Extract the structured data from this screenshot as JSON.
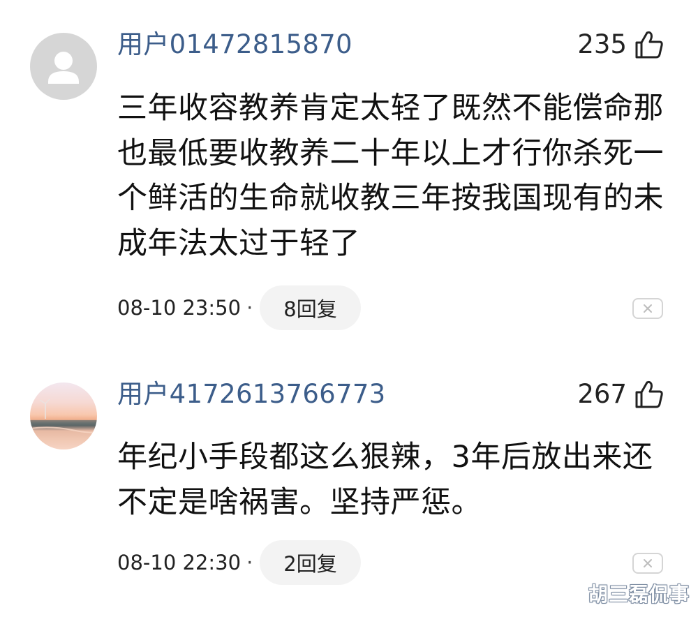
{
  "comments": [
    {
      "username": "用户01472815870",
      "avatar": "default-user-icon",
      "likes": "235",
      "content": "三年收容教养肯定太轻了既然不能偿命那也最低要收教养二十年以上才行你杀死一个鲜活的生命就收教三年按我国现有的未成年法太过于轻了",
      "time": "08-10 23:50",
      "separator": "·",
      "reply_label": "8回复"
    },
    {
      "username": "用户4172613766773",
      "avatar": "sunset-wind-turbine-photo",
      "likes": "267",
      "content": "年纪小手段都这么狠辣，3年后放出来还不定是啥祸害。坚持严惩。",
      "time": "08-10 22:30",
      "separator": "·",
      "reply_label": "2回复"
    }
  ],
  "watermark": "胡三磊侃事",
  "colors": {
    "username": "#3c5d8a",
    "reply_pill_bg": "#f3f3f3",
    "avatar_default_bg": "#d6d6d6"
  },
  "icons": {
    "like": "thumbs-up-icon",
    "dismiss": "close-icon"
  }
}
